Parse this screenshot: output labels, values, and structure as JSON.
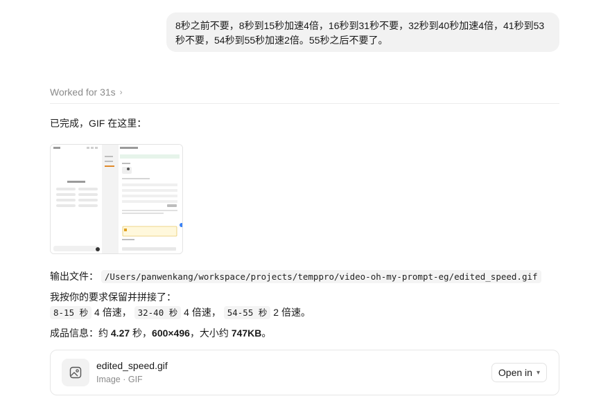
{
  "user_message": {
    "line1": "8秒之前不要，8秒到15秒加速4倍，16秒到31秒不要，32秒到40秒加速4倍，41秒到53",
    "line2": "秒不要，54秒到55秒加速2倍。55秒之后不要了。"
  },
  "worked": {
    "label": "Worked for 31s"
  },
  "reply": {
    "done_text": "已完成，GIF 在这里：",
    "output_label": "输出文件：",
    "output_path": "/Users/panwenkang/workspace/projects/temppro/video-oh-my-prompt-eg/edited_speed.gif",
    "kept_label": "我按你的要求保留并拼接了：",
    "seg1": "8-15 秒",
    "seg1_speed": "4 倍速，",
    "seg2": "32-40 秒",
    "seg2_speed": "4 倍速，",
    "seg3": "54-55 秒",
    "seg3_speed": "2 倍速。",
    "info_label": "成品信息：约 ",
    "duration": "4.27",
    "info_sec": " 秒，",
    "dims": "600×496",
    "info_size_label": "，大小约 ",
    "size": "747KB",
    "info_end": "。"
  },
  "file_card": {
    "name": "edited_speed.gif",
    "meta": "Image · GIF",
    "open_label": "Open in"
  },
  "colors": {
    "accent": "#3b82f6",
    "bubble": "#f2f2f2",
    "muted": "#8a8a8a"
  }
}
